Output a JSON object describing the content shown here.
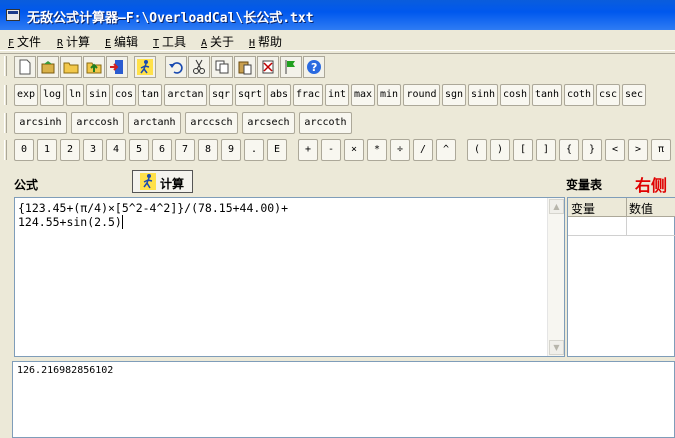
{
  "window": {
    "title": "无敌公式计算器—F:\\OverloadCal\\长公式.txt"
  },
  "menu": [
    {
      "key": "F",
      "label": "文件"
    },
    {
      "key": "R",
      "label": "计算"
    },
    {
      "key": "E",
      "label": "编辑"
    },
    {
      "key": "T",
      "label": "工具"
    },
    {
      "key": "A",
      "label": "关于"
    },
    {
      "key": "H",
      "label": "帮助"
    }
  ],
  "toolbar_icons": [
    "new-file-icon",
    "open-icon",
    "folder-icon",
    "folder-up-icon",
    "exit-door-icon",
    "run-man-icon",
    "undo-icon",
    "cut-icon",
    "copy-icon",
    "paste-icon",
    "clear-icon",
    "flag-icon",
    "help-icon"
  ],
  "functions_row1": [
    "exp",
    "log",
    "ln",
    "sin",
    "cos",
    "tan",
    "arctan",
    "sqr",
    "sqrt",
    "abs",
    "frac",
    "int",
    "max",
    "min",
    "round",
    "sgn",
    "sinh",
    "cosh",
    "tanh",
    "coth",
    "csc",
    "sec"
  ],
  "functions_row2": [
    "arcsinh",
    "arccosh",
    "arctanh",
    "arccsch",
    "arcsech",
    "arccoth"
  ],
  "keys_row": [
    "0",
    "1",
    "2",
    "3",
    "4",
    "5",
    "6",
    "7",
    "8",
    "9",
    ".",
    "E",
    "+",
    "-",
    "×",
    "*",
    "÷",
    "/",
    "^",
    "(",
    ")",
    "[",
    "]",
    "{",
    "}",
    "<",
    ">",
    "π"
  ],
  "labels": {
    "formula": "公式",
    "calculate": "计算",
    "variables": "变量表",
    "right_side": "右侧"
  },
  "editor": {
    "line1": "{123.45+(π/4)×[5^2-4^2]}/(78.15+44.00)+",
    "line2": "124.55+sin(2.5)"
  },
  "var_table": {
    "col_name": "变量",
    "col_value": "数值"
  },
  "result": {
    "value": "126.216982856102"
  },
  "colors": {
    "titlebar": "#0058ee",
    "accent_red": "#e00000",
    "face": "#ece9d8"
  }
}
